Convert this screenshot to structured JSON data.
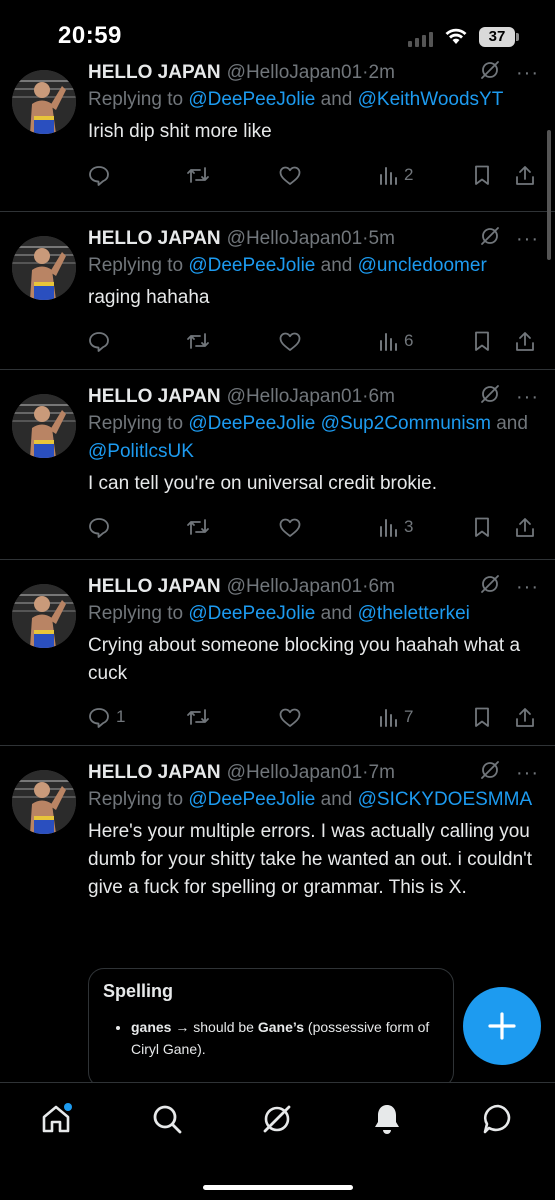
{
  "status_bar": {
    "time": "20:59",
    "battery": "37"
  },
  "author": {
    "name": "HELLO JAPAN",
    "handle": "@HelloJapan01"
  },
  "tweets": [
    {
      "time": "·2m",
      "reply_prefix": "Replying to ",
      "reply_links": [
        "@DeePeeJolie",
        " and ",
        "@KeithWoodsYT"
      ],
      "text": "Irish dip shit more like",
      "replies": "",
      "views": "2"
    },
    {
      "time": "·5m",
      "reply_prefix": "Replying to ",
      "reply_links": [
        "@DeePeeJolie",
        " and ",
        "@uncledoomer"
      ],
      "text": "raging hahaha",
      "replies": "",
      "views": "6"
    },
    {
      "time": "·6m",
      "reply_prefix": "Replying to ",
      "reply_links": [
        "@DeePeeJolie",
        " ",
        "@Sup2Communism",
        " and ",
        "@PolitlcsUK"
      ],
      "text": "I can tell you're on universal credit brokie.",
      "replies": "",
      "views": "3"
    },
    {
      "time": "·6m",
      "reply_prefix": "Replying to ",
      "reply_links": [
        "@DeePeeJolie",
        " and ",
        "@theletterkei"
      ],
      "text": "Crying about someone blocking you haahah what a cuck",
      "replies": "1",
      "views": "7"
    },
    {
      "time": "·7m",
      "reply_prefix": "Replying to ",
      "reply_links": [
        "@DeePeeJolie",
        " and ",
        "@SICKYDOESMMA"
      ],
      "text": "Here's your multiple errors. I was actually calling you dumb for your shitty take he wanted an out. i couldn't give a fuck for spelling or grammar. This is X.",
      "replies": "",
      "views": ""
    }
  ],
  "quoted_card": {
    "title": "Spelling",
    "item_term": "ganes",
    "item_arrow": " → should be ",
    "item_fix": "Gane’s",
    "item_rest": " (possessive form of Ciryl Gane)."
  },
  "more_glyph": "···",
  "icons": [
    "reply-icon",
    "retweet-icon",
    "like-icon",
    "views-icon",
    "bookmark-icon",
    "share-icon",
    "grok-icon",
    "more-icon",
    "compose-icon",
    "home-icon",
    "search-icon",
    "notifications-icon",
    "messages-icon"
  ],
  "colors": {
    "accent": "#1d9bf0",
    "muted": "#71767b",
    "text": "#e7e9ea",
    "divider": "#2f3336"
  }
}
